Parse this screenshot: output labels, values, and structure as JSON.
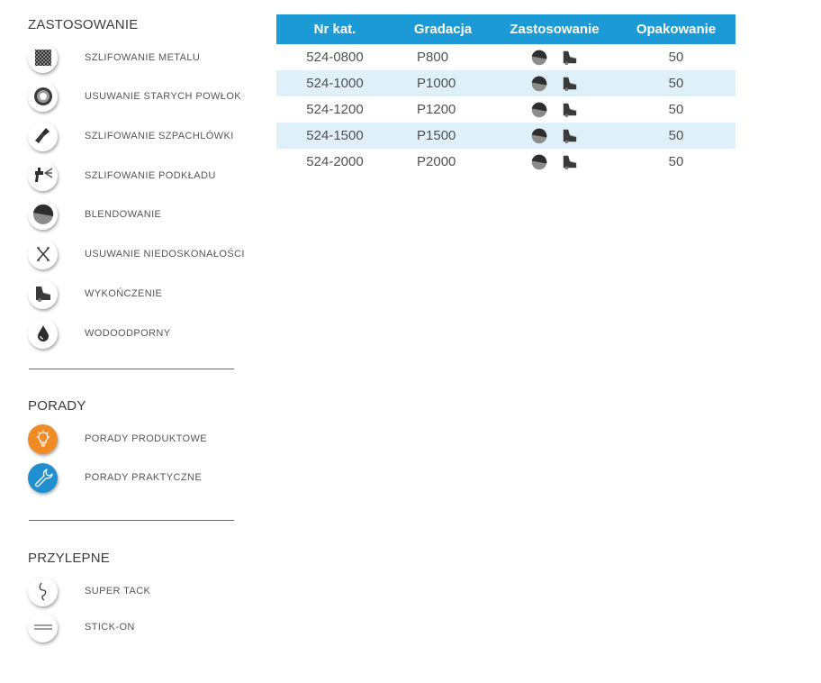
{
  "legend_zastosowanie": {
    "title": "ZASTOSOWANIE",
    "items": [
      {
        "icon": "metal-grinding-icon",
        "label": "SZLIFOWANIE METALU"
      },
      {
        "icon": "coating-removal-icon",
        "label": "USUWANIE STARYCH POWŁOK"
      },
      {
        "icon": "spatula-icon",
        "label": "SZLIFOWANIE SZPACHLÓWKI"
      },
      {
        "icon": "spray-gun-icon",
        "label": "SZLIFOWANIE PODKŁADU"
      },
      {
        "icon": "blending-icon",
        "label": "BLENDOWANIE"
      },
      {
        "icon": "x-imperfection-icon",
        "label": "USUWANIE NIEDOSKONAŁOŚCI"
      },
      {
        "icon": "car-finish-icon",
        "label": "WYKOŃCZENIE"
      },
      {
        "icon": "water-drop-icon",
        "label": "WODOODPORNY"
      }
    ]
  },
  "legend_porady": {
    "title": "PORADY",
    "items": [
      {
        "icon": "lightbulb-icon",
        "label": "PORADY PRODUKTOWE",
        "color": "#f08a24"
      },
      {
        "icon": "wrench-icon",
        "label": "PORADY PRAKTYCZNE",
        "color": "#1f8fcf"
      }
    ]
  },
  "legend_przylepne": {
    "title": "PRZYLEPNE",
    "items": [
      {
        "icon": "super-tack-icon",
        "label": "SUPER TACK"
      },
      {
        "icon": "stick-on-icon",
        "label": "STICK-ON"
      }
    ]
  },
  "table": {
    "header_color": "#1b9ad6",
    "alt_row_color": "#dff0f8",
    "columns": [
      "Nr kat.",
      "Gradacja",
      "Zastosowanie",
      "Opakowanie"
    ],
    "rows": [
      {
        "nr": "524-0800",
        "grad": "P800",
        "uses": [
          "blending-icon",
          "car-finish-icon"
        ],
        "pack": "50"
      },
      {
        "nr": "524-1000",
        "grad": "P1000",
        "uses": [
          "blending-icon",
          "car-finish-icon"
        ],
        "pack": "50"
      },
      {
        "nr": "524-1200",
        "grad": "P1200",
        "uses": [
          "blending-icon",
          "car-finish-icon"
        ],
        "pack": "50"
      },
      {
        "nr": "524-1500",
        "grad": "P1500",
        "uses": [
          "blending-icon",
          "car-finish-icon"
        ],
        "pack": "50"
      },
      {
        "nr": "524-2000",
        "grad": "P2000",
        "uses": [
          "blending-icon",
          "car-finish-icon"
        ],
        "pack": "50"
      }
    ]
  }
}
